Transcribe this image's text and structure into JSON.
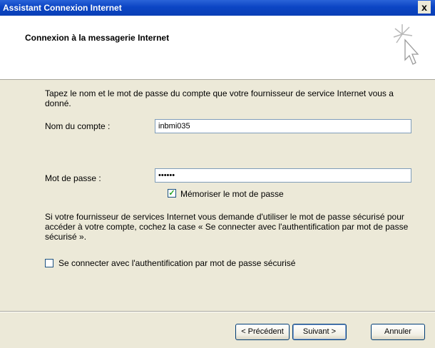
{
  "window": {
    "title": "Assistant Connexion Internet",
    "close_label": "x"
  },
  "header": {
    "heading": "Connexion à la messagerie Internet",
    "icon": "wizard-cursor-icon"
  },
  "body": {
    "instructions": "Tapez le nom et le mot de passe du compte que votre fournisseur de service Internet vous a donné.",
    "account_label": "Nom du compte :",
    "account_value": "inbmi035",
    "password_label": "Mot de passe :",
    "password_value": "••••••",
    "remember_label": "Mémoriser le mot de passe",
    "remember_checked": true,
    "spa_info": "Si votre fournisseur de services Internet vous demande d'utiliser le mot de passe sécurisé pour accéder à votre compte, cochez la case « Se connecter avec l'authentification par mot de passe sécurisé ».",
    "spa_label": "Se connecter avec l'authentification par mot de passe sécurisé",
    "spa_checked": false
  },
  "buttons": {
    "back": "< Précédent",
    "next": "Suivant >",
    "cancel": "Annuler"
  },
  "colors": {
    "titlebar": "#0b45c4",
    "dialog_bg": "#ece9d8",
    "header_bg": "#ffffff"
  }
}
